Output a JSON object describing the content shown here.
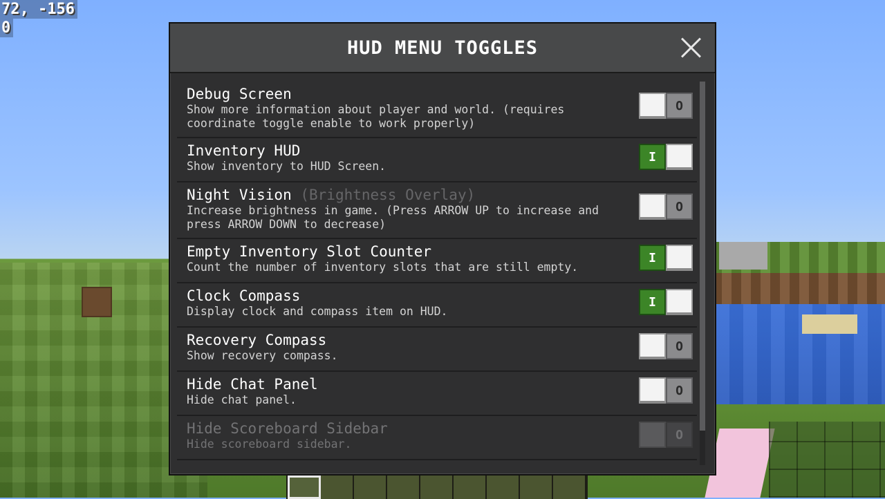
{
  "hud": {
    "coord_line_1": "72, -156",
    "coord_line_2": "0"
  },
  "modal": {
    "title": "HUD MENU TOGGLES",
    "close_icon": "close-x-icon"
  },
  "toggle_glyphs": {
    "on": "I",
    "off": "O"
  },
  "rows": [
    {
      "title": "Debug Screen",
      "suffix": "",
      "description": "Show more information about player and world. (requires coordinate toggle enable to work properly)",
      "enabled": false,
      "disabled": false
    },
    {
      "title": "Inventory HUD",
      "suffix": "",
      "description": "Show inventory to HUD Screen.",
      "enabled": true,
      "disabled": false
    },
    {
      "title": "Night Vision",
      "suffix": "(Brightness Overlay)",
      "description": "Increase brightness in game. (Press ARROW UP to increase and press ARROW DOWN to decrease)",
      "enabled": false,
      "disabled": false
    },
    {
      "title": "Empty Inventory Slot Counter",
      "suffix": "",
      "description": "Count the number of inventory slots that are still empty.",
      "enabled": true,
      "disabled": false
    },
    {
      "title": "Clock Compass",
      "suffix": "",
      "description": "Display clock and compass item on HUD.",
      "enabled": true,
      "disabled": false
    },
    {
      "title": "Recovery Compass",
      "suffix": "",
      "description": "Show recovery compass.",
      "enabled": false,
      "disabled": false
    },
    {
      "title": "Hide Chat Panel",
      "suffix": "",
      "description": "Hide chat panel.",
      "enabled": false,
      "disabled": false
    },
    {
      "title": "Hide Scoreboard Sidebar",
      "suffix": "",
      "description": "Hide scoreboard sidebar.",
      "enabled": false,
      "disabled": true
    }
  ],
  "hotbar": {
    "slot_count": 9,
    "selected_index": 0
  },
  "colors": {
    "toggle_on": "#3c8527",
    "toggle_off": "#8b8b8d",
    "panel_bg": "#2f2f30",
    "header_bg": "#48494a"
  }
}
